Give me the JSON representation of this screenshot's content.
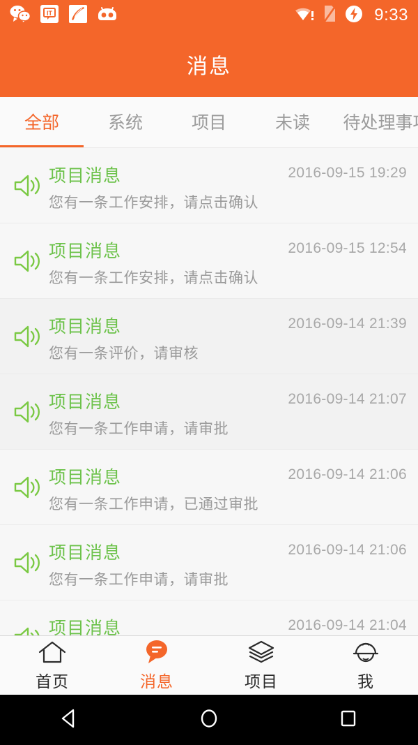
{
  "status_bar": {
    "background": "#f4662a",
    "time": "9:33",
    "left_icons": [
      "wechat-icon",
      "it-bubble-icon",
      "feather-icon",
      "cyanogenmod-icon"
    ],
    "right_icons": [
      "wifi-alert-icon",
      "sim-missing-icon",
      "charging-bolt-icon"
    ]
  },
  "header": {
    "title": "消息",
    "background": "#f4662a",
    "text_color": "#ffffff"
  },
  "tabs": {
    "active_index": 0,
    "accent": "#f4662a",
    "inactive_color": "#9b9b9b",
    "items": [
      {
        "label": "全部"
      },
      {
        "label": "系统"
      },
      {
        "label": "项目"
      },
      {
        "label": "未读"
      },
      {
        "label": "待处理事项"
      }
    ]
  },
  "messages": {
    "title_color": "#6cc24a",
    "icon": "speaker-icon",
    "items": [
      {
        "title": "项目消息",
        "date": "2016-09-15 19:29",
        "body": "您有一条工作安排，请点击确认"
      },
      {
        "title": "项目消息",
        "date": "2016-09-15 12:54",
        "body": "您有一条工作安排，请点击确认"
      },
      {
        "title": "项目消息",
        "date": "2016-09-14 21:39",
        "body": "您有一条评价，请审核"
      },
      {
        "title": "项目消息",
        "date": "2016-09-14 21:07",
        "body": "您有一条工作申请，请审批"
      },
      {
        "title": "项目消息",
        "date": "2016-09-14 21:06",
        "body": "您有一条工作申请，已通过审批"
      },
      {
        "title": "项目消息",
        "date": "2016-09-14 21:06",
        "body": "您有一条工作申请，请审批"
      },
      {
        "title": "项目消息",
        "date": "2016-09-14 21:04",
        "body": ""
      }
    ]
  },
  "bottom_nav": {
    "active_index": 1,
    "accent": "#f4662a",
    "items": [
      {
        "label": "首页",
        "icon": "home-icon"
      },
      {
        "label": "消息",
        "icon": "chat-bubble-icon"
      },
      {
        "label": "项目",
        "icon": "layers-icon"
      },
      {
        "label": "我",
        "icon": "hard-hat-icon"
      }
    ]
  },
  "system_nav": {
    "buttons": [
      "back-triangle-icon",
      "home-circle-icon",
      "recents-square-icon"
    ]
  }
}
